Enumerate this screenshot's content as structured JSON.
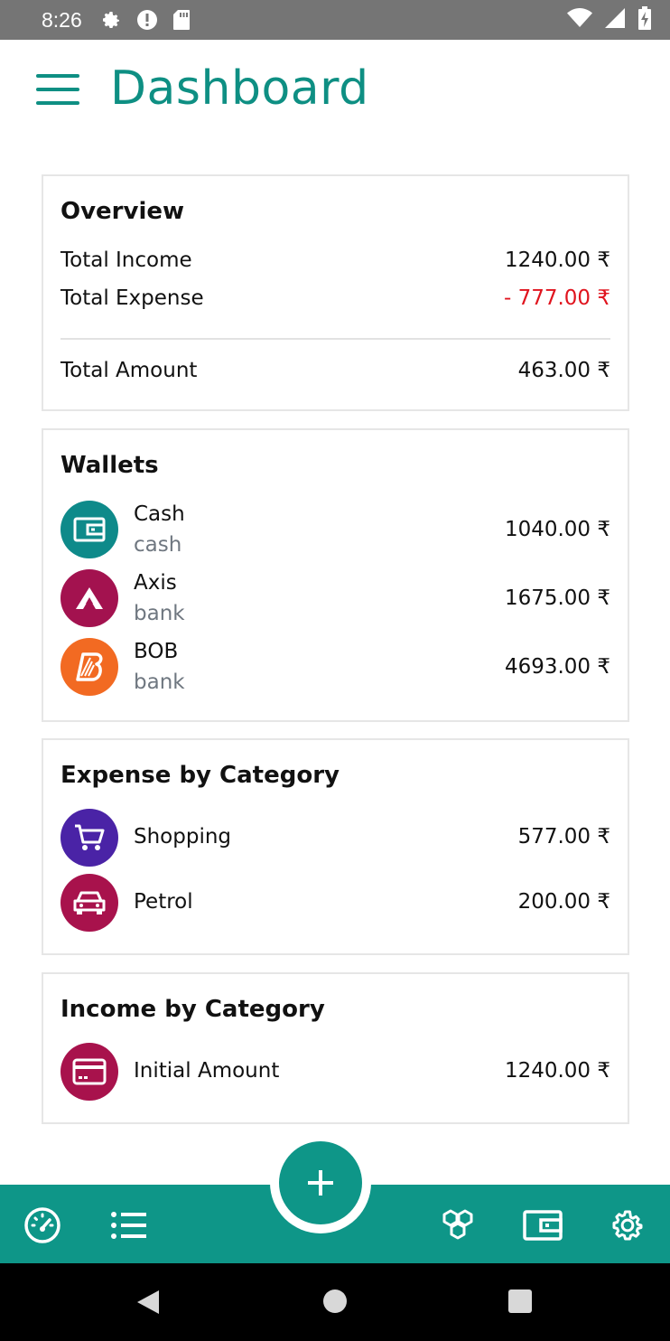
{
  "status_bar": {
    "time": "8:26",
    "icons": [
      "settings-icon",
      "alert-icon",
      "sd-card-icon",
      "wifi-icon",
      "signal-icon",
      "battery-charging-icon"
    ]
  },
  "header": {
    "title": "Dashboard",
    "menu_icon": "hamburger-menu-icon"
  },
  "overview": {
    "title": "Overview",
    "income_label": "Total Income",
    "income_value": "1240.00 ₹",
    "expense_label": "Total Expense",
    "expense_value": "- 777.00 ₹",
    "total_label": "Total Amount",
    "total_value": "463.00 ₹",
    "expense_color": "#e0141e"
  },
  "wallets": {
    "title": "Wallets",
    "items": [
      {
        "name": "Cash",
        "type": "cash",
        "amount": "1040.00 ₹",
        "icon": "wallet-icon",
        "color": "#0e8a8a"
      },
      {
        "name": "Axis",
        "type": "bank",
        "amount": "1675.00 ₹",
        "icon": "axis-bank-logo-icon",
        "color": "#a3124f"
      },
      {
        "name": "BOB",
        "type": "bank",
        "amount": "4693.00 ₹",
        "icon": "bob-bank-logo-icon",
        "color": "#f26a22"
      }
    ]
  },
  "expense_by_category": {
    "title": "Expense by Category",
    "items": [
      {
        "name": "Shopping",
        "amount": "577.00 ₹",
        "icon": "shopping-cart-icon",
        "color": "#4a23a6"
      },
      {
        "name": "Petrol",
        "amount": "200.00 ₹",
        "icon": "car-icon",
        "color": "#a8124c"
      }
    ]
  },
  "income_by_category": {
    "title": "Income by Category",
    "items": [
      {
        "name": "Initial Amount",
        "amount": "1240.00 ₹",
        "icon": "credit-card-icon",
        "color": "#a8124c"
      }
    ]
  },
  "bottom_nav": {
    "items": [
      "dashboard-gauge-icon",
      "transactions-list-icon",
      "categories-icon",
      "wallets-icon",
      "settings-icon"
    ],
    "fab_icon": "add-icon",
    "color": "#0e9688"
  },
  "system_nav": {
    "items": [
      "back-icon",
      "home-icon",
      "recents-icon"
    ]
  }
}
